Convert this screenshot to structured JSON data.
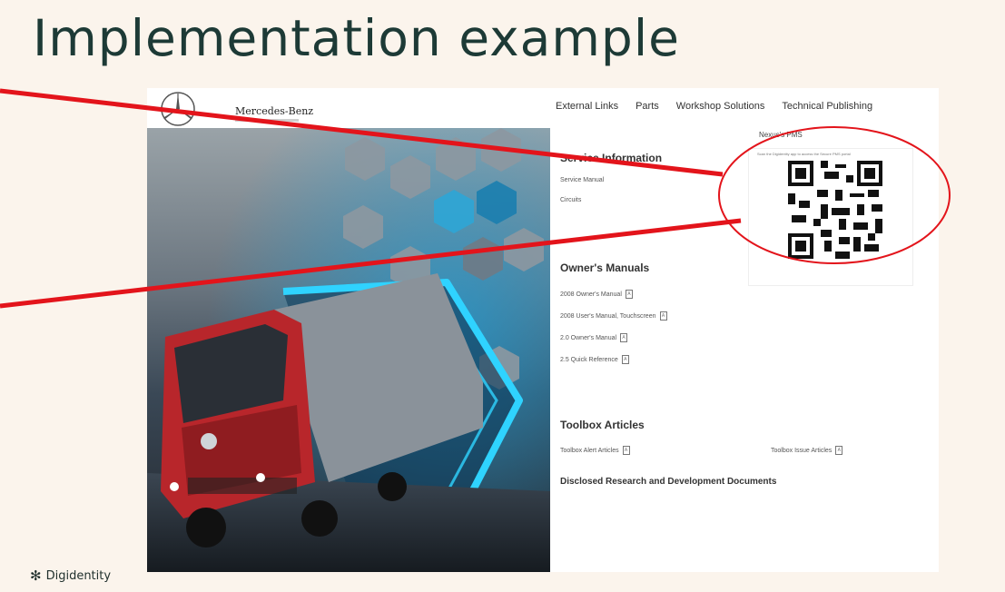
{
  "slide": {
    "title": "Implementation example",
    "footer_logo": "Digidentity"
  },
  "site": {
    "brand": "Mercedes-Benz",
    "nav": [
      "External Links",
      "Parts",
      "Workshop Solutions",
      "Technical Publishing"
    ]
  },
  "service": {
    "heading": "Service Information",
    "links": [
      "Service Manual",
      "Circuits"
    ]
  },
  "qr": {
    "title": "Nexus's PMS",
    "caption": "Scan the Digidentity app to access the Secure PMS portal"
  },
  "owners": {
    "heading": "Owner's Manuals",
    "links": [
      "2008 Owner's Manual",
      "2008 User's Manual, Touchscreen",
      "2.0 Owner's Manual",
      "2.5 Quick Reference"
    ]
  },
  "toolbox": {
    "heading": "Toolbox Articles",
    "links": [
      "Toolbox Alert Articles",
      "Toolbox Issue Articles"
    ]
  },
  "disclosed": {
    "heading": "Disclosed Research and Development Documents"
  },
  "colors": {
    "background": "#fbf4ec",
    "title": "#1d3a36",
    "annotation": "#e3141b",
    "truck": "#b8262b",
    "neon": "#2fd3ff"
  },
  "icons": [
    "mercedes-star-icon",
    "pdf-icon",
    "qr-code-icon",
    "sparkle-icon"
  ]
}
